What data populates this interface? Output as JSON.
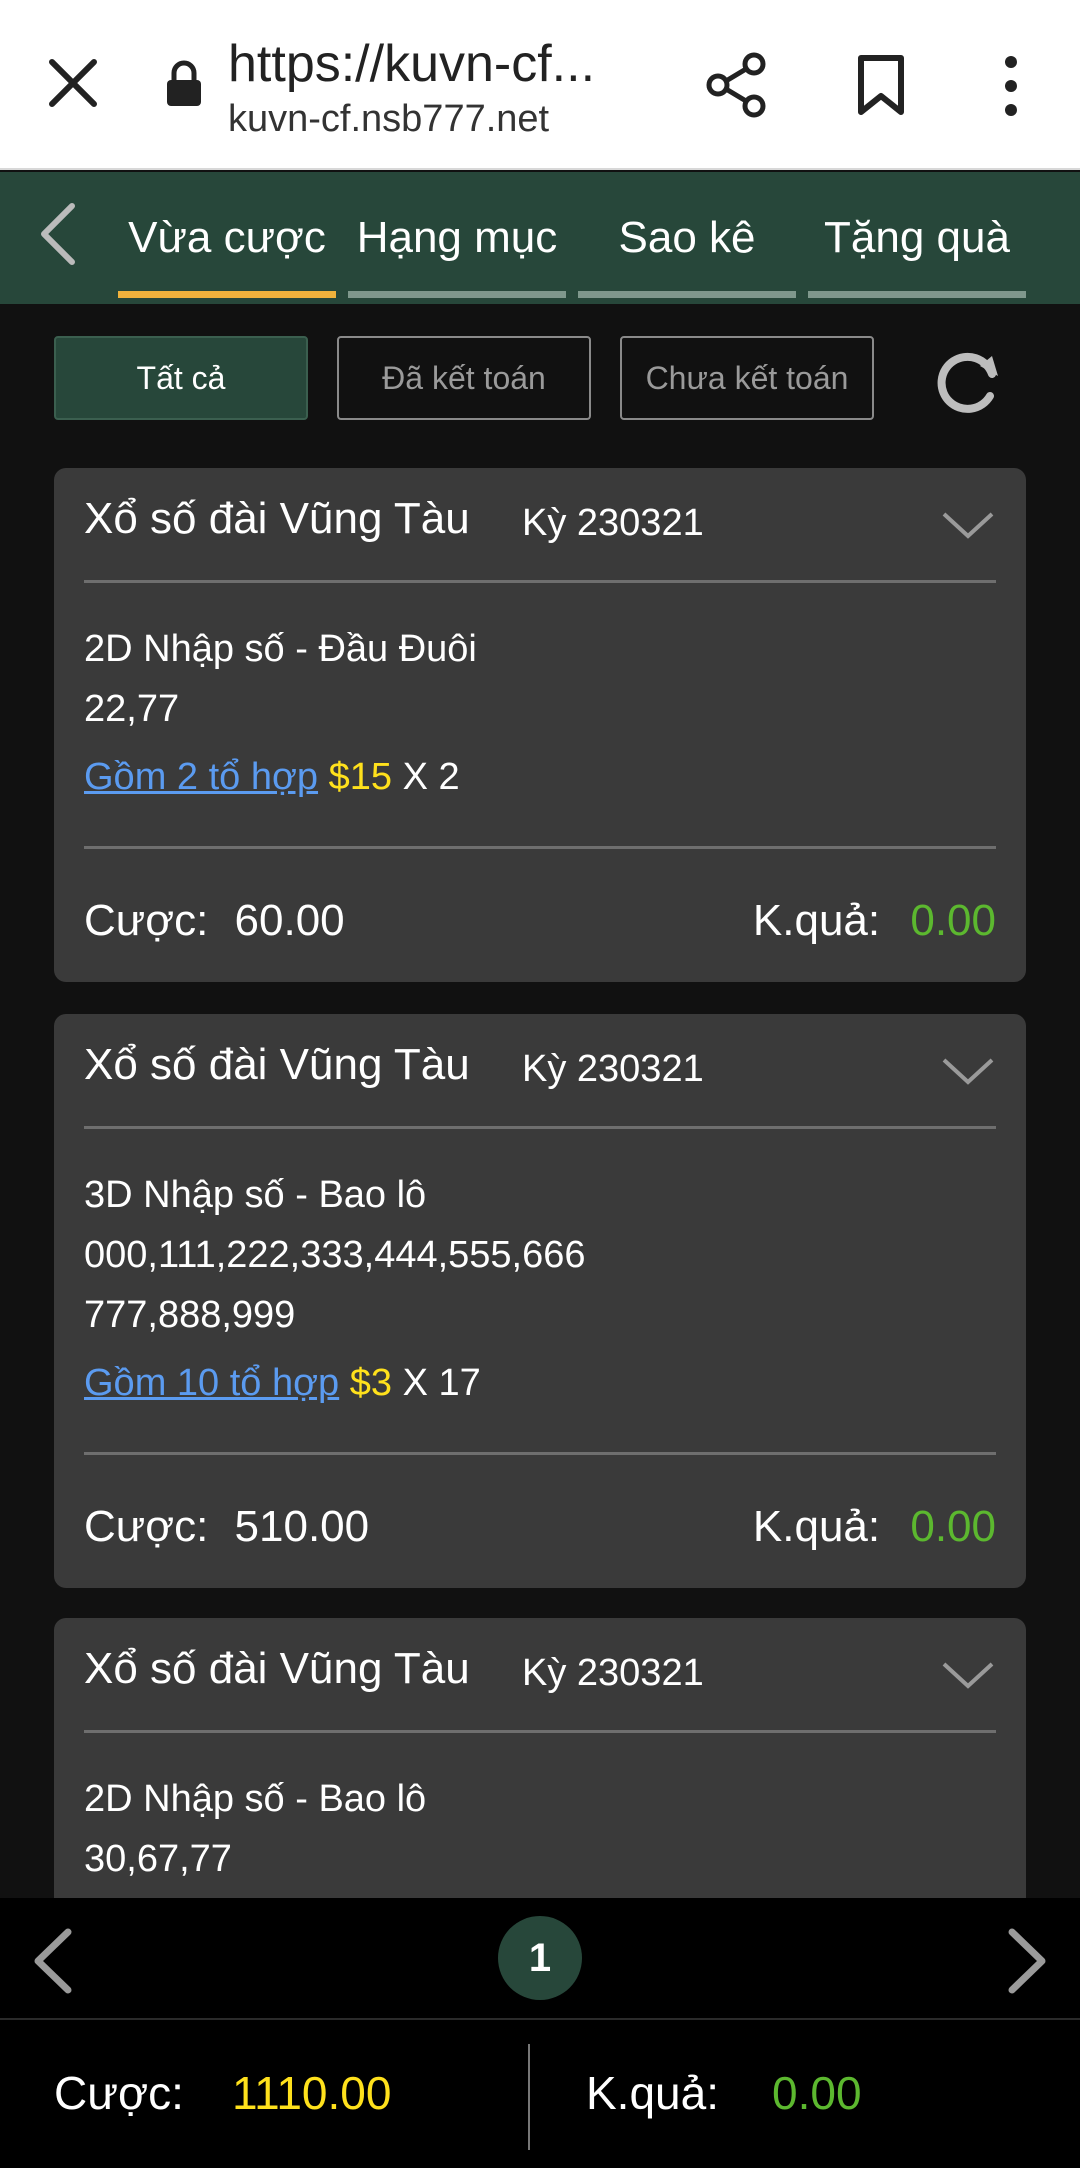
{
  "browser": {
    "title": "https://kuvn-cf...",
    "domain": "kuvn-cf.nsb777.net"
  },
  "tabs": [
    {
      "label": "Vừa cược",
      "active": true
    },
    {
      "label": "Hạng mục",
      "active": false
    },
    {
      "label": "Sao kê",
      "active": false
    },
    {
      "label": "Tặng quà",
      "active": false
    }
  ],
  "filters": [
    {
      "label": "Tất cả",
      "active": true
    },
    {
      "label": "Đã kết toán",
      "active": false
    },
    {
      "label": "Chưa kết toán",
      "active": false
    }
  ],
  "bets": [
    {
      "lottery": "Xổ số đài Vũng Tàu",
      "period": "Kỳ 230321",
      "type": "2D Nhập số - Đầu Đuôi",
      "numbers_lines": [
        "22,77"
      ],
      "combo": "Gồm 2 tổ hợp",
      "unit": "$15",
      "multiplier": "X 2",
      "stake_label": "Cược:",
      "stake": "60.00",
      "result_label": "K.quả:",
      "result": "0.00"
    },
    {
      "lottery": "Xổ số đài Vũng Tàu",
      "period": "Kỳ 230321",
      "type": "3D Nhập số - Bao lô",
      "numbers_lines": [
        "000,111,222,333,444,555,666",
        "777,888,999"
      ],
      "combo": "Gồm 10 tổ hợp",
      "unit": "$3",
      "multiplier": "X 17",
      "stake_label": "Cược:",
      "stake": "510.00",
      "result_label": "K.quả:",
      "result": "0.00"
    },
    {
      "lottery": "Xổ số đài Vũng Tàu",
      "period": "Kỳ 230321",
      "type": "2D Nhập số - Bao lô",
      "numbers_lines": [
        "30,67,77"
      ]
    }
  ],
  "pager": {
    "current": "1"
  },
  "summary": {
    "stake_label": "Cược:",
    "stake": "1110.00",
    "result_label": "K.quả:",
    "result": "0.00"
  },
  "colors": {
    "header_green": "#27473a",
    "tab_active_underline": "#f0b23c",
    "amount_yellow": "#ffe11c",
    "result_green": "#5cb82f",
    "link_blue": "#5b9bf0"
  }
}
